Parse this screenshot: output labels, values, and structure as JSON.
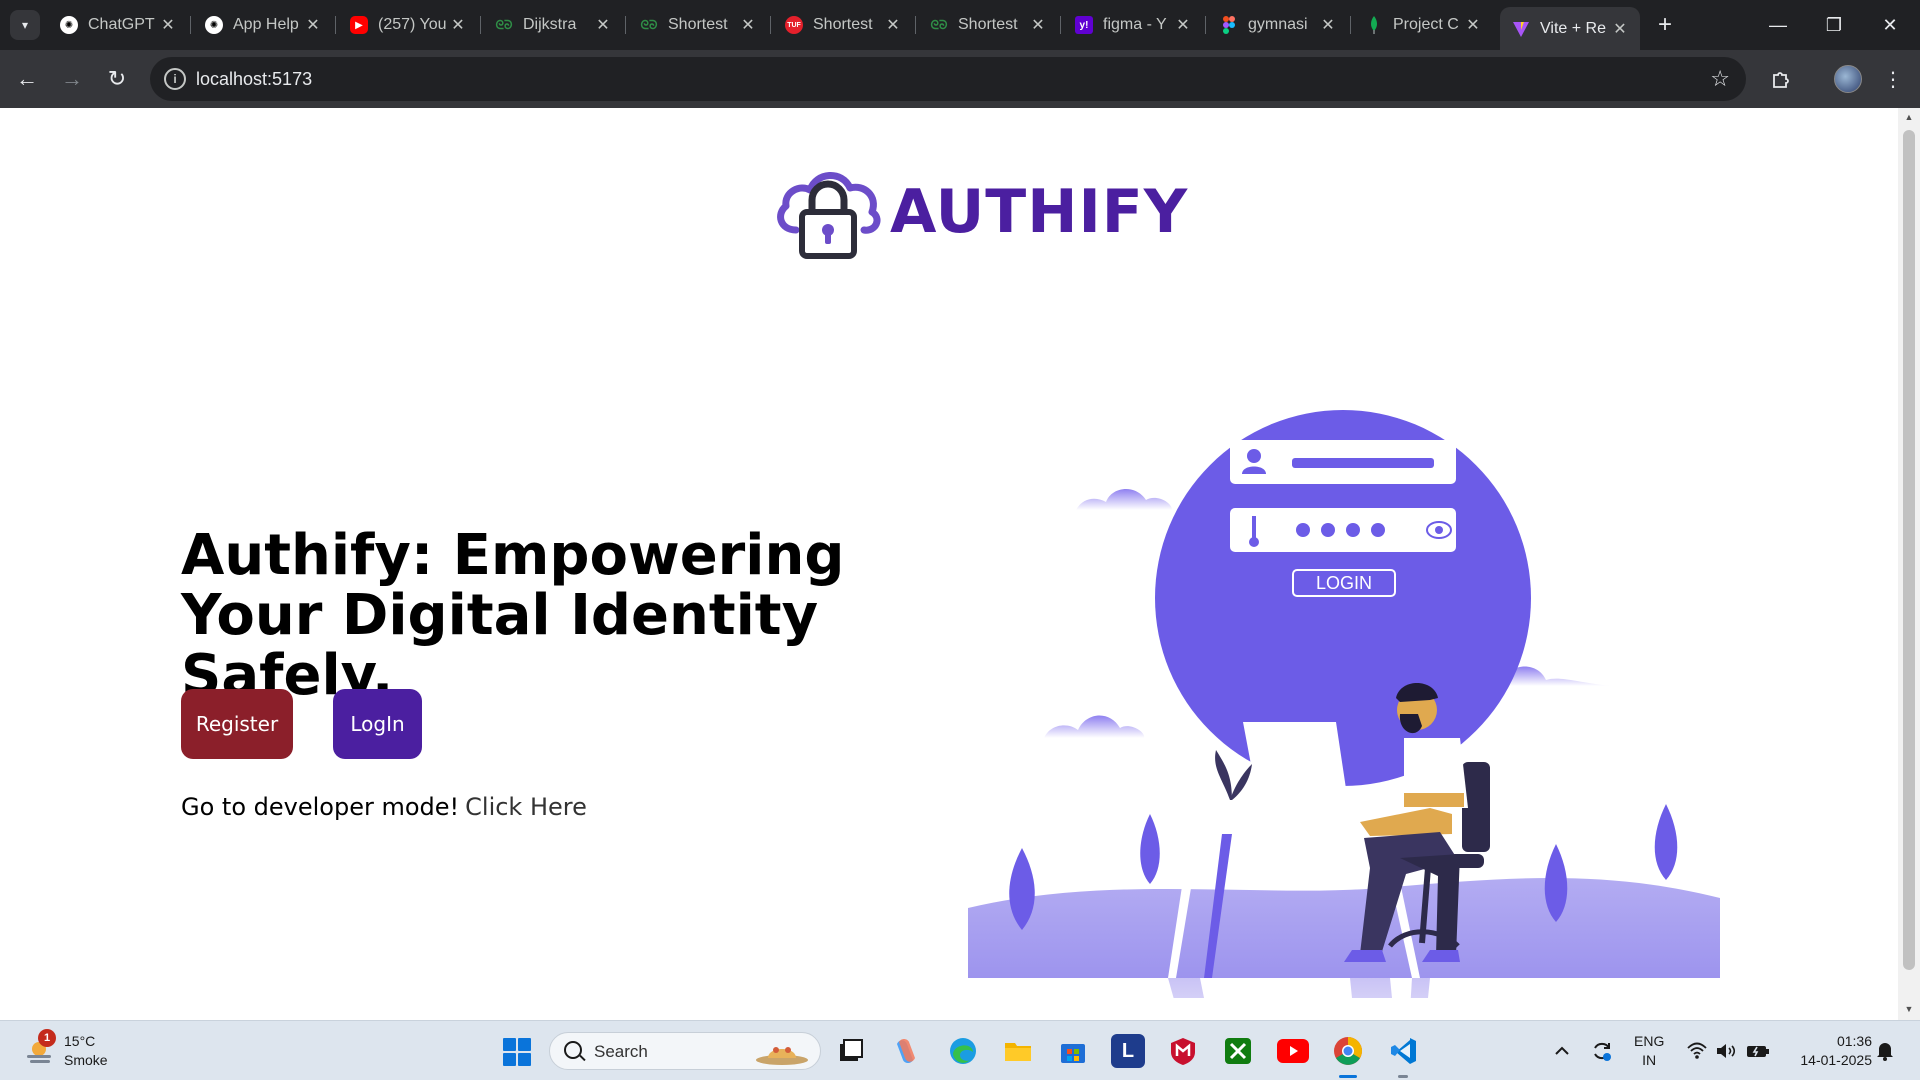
{
  "browser": {
    "tabs": [
      {
        "title": "ChatGPT",
        "icon": "openai-icon",
        "color": "#ffffff"
      },
      {
        "title": "App Help",
        "icon": "openai-icon",
        "color": "#ffffff"
      },
      {
        "title": "(257) You",
        "icon": "youtube-icon",
        "color": "#ff0000"
      },
      {
        "title": "Dijkstra",
        "icon": "geeksforgeeks-icon",
        "color": "#2f8d46"
      },
      {
        "title": "Shortest",
        "icon": "geeksforgeeks-icon",
        "color": "#2f8d46"
      },
      {
        "title": "Shortest",
        "icon": "tuf-icon",
        "color": "#e4202b"
      },
      {
        "title": "Shortest",
        "icon": "geeksforgeeks-icon",
        "color": "#2f8d46"
      },
      {
        "title": "figma - Y",
        "icon": "yahoo-icon",
        "color": "#6001d2"
      },
      {
        "title": "gymnasi",
        "icon": "figma-icon",
        "color": "#f24e1e"
      },
      {
        "title": "Project C",
        "icon": "mongodb-icon",
        "color": "#13aa52"
      },
      {
        "title": "Vite + Re",
        "icon": "vite-icon",
        "color": "#a855f7",
        "active": true
      }
    ],
    "url": "localhost:5173"
  },
  "page": {
    "brand": "AUTHIFY",
    "headline": "Authify: Empowering Your Digital Identity Safely.",
    "register_label": "Register",
    "login_label": "LogIn",
    "dev_text": "Go to developer mode!",
    "dev_link": "Click Here",
    "illustration": {
      "login_label": "LOGIN"
    },
    "colors": {
      "brand": "#4b1fa0",
      "register": "#8b1f2a",
      "accent": "#6c5ce7"
    }
  },
  "taskbar": {
    "weather_badge": "1",
    "temperature": "15°C",
    "condition": "Smoke",
    "search_placeholder": "Search",
    "lang_line1": "ENG",
    "lang_line2": "IN",
    "time": "01:36",
    "date": "14-01-2025"
  }
}
